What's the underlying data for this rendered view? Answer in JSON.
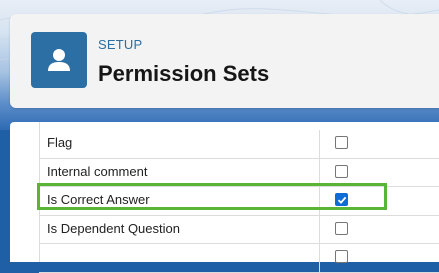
{
  "header": {
    "breadcrumb": "SETUP",
    "title": "Permission Sets",
    "icon": "user-icon"
  },
  "fields": [
    {
      "label": "Flag",
      "checked": false
    },
    {
      "label": "Internal comment",
      "checked": false
    },
    {
      "label": "Is Correct Answer",
      "checked": true,
      "highlighted": true
    },
    {
      "label": "Is Dependent Question",
      "checked": false
    },
    {
      "label": "",
      "checked": false
    }
  ],
  "colors": {
    "accent": "#2b6fa4",
    "highlight": "#5ab537",
    "checkbox_checked": "#0f6bd6"
  }
}
